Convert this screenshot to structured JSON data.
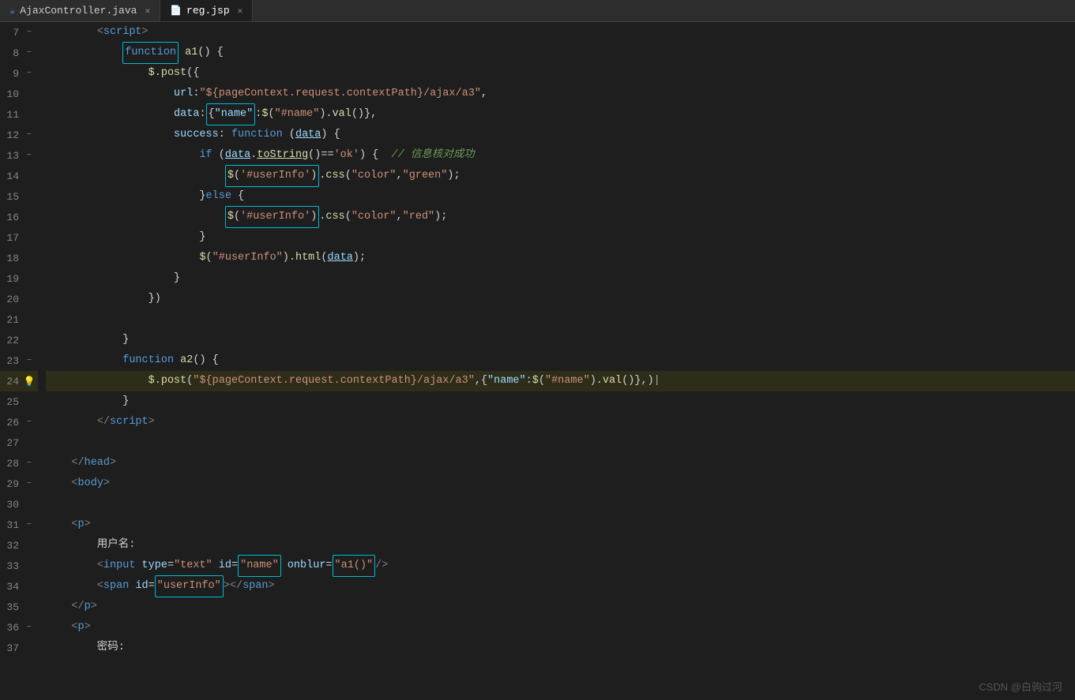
{
  "tabs": [
    {
      "id": "ajaxcontroller",
      "label": "AjaxController.java",
      "active": false,
      "icon": "java-icon"
    },
    {
      "id": "regjsp",
      "label": "reg.jsp",
      "active": true,
      "icon": "jsp-icon"
    }
  ],
  "lines": [
    {
      "num": 7,
      "fold": "minus",
      "warn": false,
      "highlighted": false
    },
    {
      "num": 8,
      "fold": "minus",
      "warn": false,
      "highlighted": false
    },
    {
      "num": 9,
      "fold": "minus",
      "warn": false,
      "highlighted": false
    },
    {
      "num": 10,
      "fold": null,
      "warn": false,
      "highlighted": false
    },
    {
      "num": 11,
      "fold": null,
      "warn": false,
      "highlighted": false
    },
    {
      "num": 12,
      "fold": "minus",
      "warn": false,
      "highlighted": false
    },
    {
      "num": 13,
      "fold": "minus",
      "warn": false,
      "highlighted": false
    },
    {
      "num": 14,
      "fold": null,
      "warn": false,
      "highlighted": false
    },
    {
      "num": 15,
      "fold": null,
      "warn": false,
      "highlighted": false
    },
    {
      "num": 16,
      "fold": null,
      "warn": false,
      "highlighted": false
    },
    {
      "num": 17,
      "fold": null,
      "warn": false,
      "highlighted": false
    },
    {
      "num": 18,
      "fold": null,
      "warn": false,
      "highlighted": false
    },
    {
      "num": 19,
      "fold": null,
      "warn": false,
      "highlighted": false
    },
    {
      "num": 20,
      "fold": null,
      "warn": false,
      "highlighted": false
    },
    {
      "num": 21,
      "fold": null,
      "warn": false,
      "highlighted": false
    },
    {
      "num": 22,
      "fold": null,
      "warn": false,
      "highlighted": false
    },
    {
      "num": 23,
      "fold": "minus",
      "warn": false,
      "highlighted": false
    },
    {
      "num": 24,
      "fold": null,
      "warn": true,
      "highlighted": true
    },
    {
      "num": 25,
      "fold": null,
      "warn": false,
      "highlighted": false
    },
    {
      "num": 26,
      "fold": "minus",
      "warn": false,
      "highlighted": false
    },
    {
      "num": 27,
      "fold": null,
      "warn": false,
      "highlighted": false
    },
    {
      "num": 28,
      "fold": "minus",
      "warn": false,
      "highlighted": false
    },
    {
      "num": 29,
      "fold": "minus",
      "warn": false,
      "highlighted": false
    },
    {
      "num": 30,
      "fold": null,
      "warn": false,
      "highlighted": false
    },
    {
      "num": 31,
      "fold": "minus",
      "warn": false,
      "highlighted": false
    },
    {
      "num": 32,
      "fold": null,
      "warn": false,
      "highlighted": false
    },
    {
      "num": 33,
      "fold": null,
      "warn": false,
      "highlighted": false
    },
    {
      "num": 34,
      "fold": null,
      "warn": false,
      "highlighted": false
    },
    {
      "num": 35,
      "fold": null,
      "warn": false,
      "highlighted": false
    },
    {
      "num": 36,
      "fold": "minus",
      "warn": false,
      "highlighted": false
    },
    {
      "num": 37,
      "fold": null,
      "warn": false,
      "highlighted": false
    }
  ],
  "watermark": "CSDN @白驹过河"
}
